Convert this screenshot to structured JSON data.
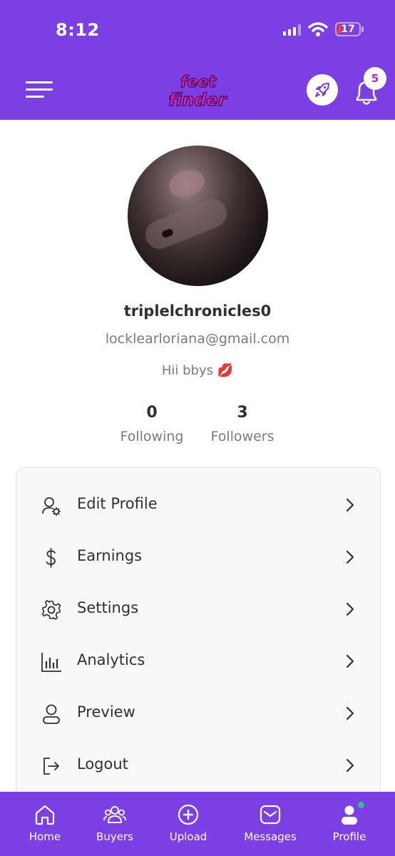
{
  "status_bar": {
    "time": "8:12",
    "battery": "17"
  },
  "header": {
    "logo_text_top": "feet",
    "logo_text_bottom": "finder",
    "notification_count": "5",
    "brand_color": "#7b3fe4",
    "logo_color": "#e21cb4"
  },
  "profile": {
    "username": "triplelchronicles0",
    "email": "locklearloriana@gmail.com",
    "bio": "Hii bbys 💋",
    "following_count": "0",
    "following_label": "Following",
    "followers_count": "3",
    "followers_label": "Followers"
  },
  "menu": [
    {
      "label": "Edit Profile",
      "icon": "user-gear-icon"
    },
    {
      "label": "Earnings",
      "icon": "dollar-icon"
    },
    {
      "label": "Settings",
      "icon": "gear-icon"
    },
    {
      "label": "Analytics",
      "icon": "bar-chart-icon"
    },
    {
      "label": "Preview",
      "icon": "person-icon"
    },
    {
      "label": "Logout",
      "icon": "logout-icon"
    }
  ],
  "tabs": [
    {
      "label": "Home",
      "icon": "home-icon"
    },
    {
      "label": "Buyers",
      "icon": "users-icon"
    },
    {
      "label": "Upload",
      "icon": "plus-circle-icon"
    },
    {
      "label": "Messages",
      "icon": "mail-icon"
    },
    {
      "label": "Profile",
      "icon": "profile-icon"
    }
  ]
}
